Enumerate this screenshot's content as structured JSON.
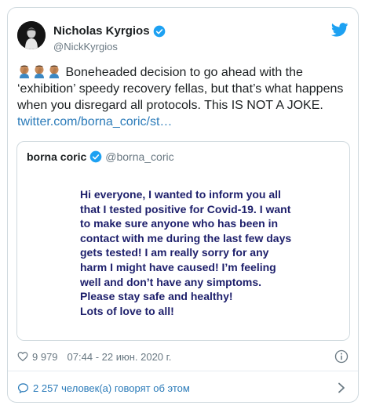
{
  "tweet": {
    "author_name": "Nicholas Kyrgios",
    "author_handle": "@NickKyrgios",
    "text": "Boneheaded decision to go ahead with the ‘exhibition’ speedy recovery fellas, but that’s what happens when you disregard all protocols. This IS NOT A JOKE.",
    "link": "twitter.com/borna_coric/st…",
    "emojis": [
      "facepalm-emoji",
      "facepalm-emoji",
      "facepalm-emoji"
    ]
  },
  "quoted": {
    "author_name": "borna coric",
    "author_handle": "@borna_coric",
    "image_text": "Hi everyone, I wanted to inform you all\nthat I tested positive for Covid-19. I want\nto make sure anyone who has been in\ncontact with me during the last few days\ngets tested! I am really sorry for any\nharm I might have caused! I’m feeling\nwell and don’t have any simptoms.\nPlease stay safe and healthy!\nLots of love to all!"
  },
  "meta": {
    "likes": "9 979",
    "timestamp": "07:44 - 22 июн. 2020 г."
  },
  "footer": {
    "conversation": "2 257 человек(а) говорят об этом"
  },
  "colors": {
    "link": "#2b7bb9",
    "verified": "#1da1f2",
    "quote_text": "#1d1f6b"
  }
}
